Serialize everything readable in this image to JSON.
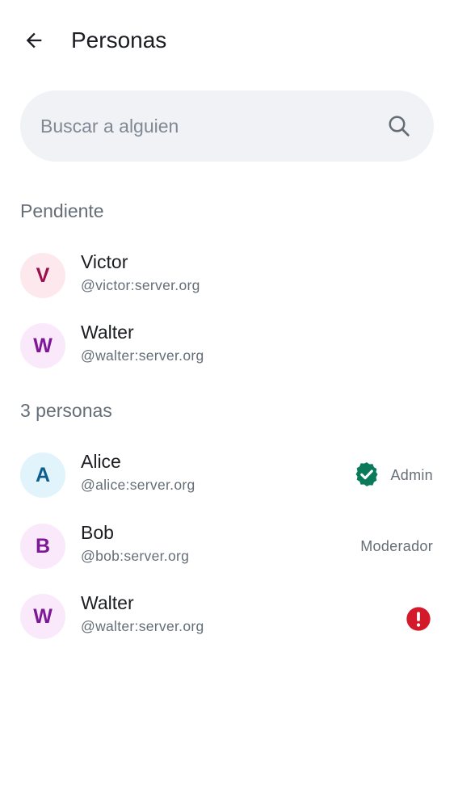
{
  "header": {
    "title": "Personas",
    "back_icon": "arrow-left-icon"
  },
  "search": {
    "placeholder": "Buscar a alguien",
    "value": "",
    "icon": "search-icon"
  },
  "pending": {
    "title": "Pendiente",
    "members": [
      {
        "initial": "V",
        "name": "Victor",
        "handle": "@victor:server.org",
        "avatar_bg": "#fde8ee",
        "avatar_fg": "#9c0f4f"
      },
      {
        "initial": "W",
        "name": "Walter",
        "handle": "@walter:server.org",
        "avatar_bg": "#f9e9fa",
        "avatar_fg": "#7d1896"
      }
    ]
  },
  "joined": {
    "title": "3 personas",
    "members": [
      {
        "initial": "A",
        "name": "Alice",
        "handle": "@alice:server.org",
        "avatar_bg": "#e1f3fb",
        "avatar_fg": "#0c5d8c",
        "role": "Admin",
        "badge": "verified-check-icon",
        "badge_color": "#0a7a5a"
      },
      {
        "initial": "B",
        "name": "Bob",
        "handle": "@bob:server.org",
        "avatar_bg": "#f9e9fa",
        "avatar_fg": "#7d1896",
        "role": "Moderador"
      },
      {
        "initial": "W",
        "name": "Walter",
        "handle": "@walter:server.org",
        "avatar_bg": "#f9e9fa",
        "avatar_fg": "#7d1896",
        "badge": "error-icon",
        "badge_color": "#d31a2a"
      }
    ]
  }
}
